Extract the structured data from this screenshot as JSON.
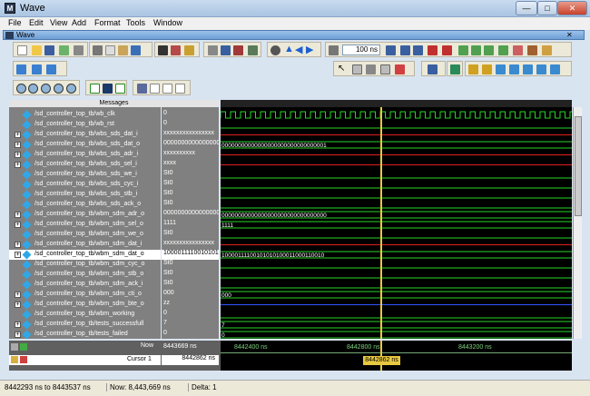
{
  "window": {
    "title": "Wave",
    "minimize": "—",
    "maximize": "□",
    "close": "✕"
  },
  "menu": [
    "File",
    "Edit",
    "View",
    "Add",
    "Format",
    "Tools",
    "Window"
  ],
  "pane": {
    "title": "Wave"
  },
  "toolbar": {
    "zoom_value": "100 ns"
  },
  "headers": {
    "messages": "Messages"
  },
  "signals": [
    {
      "name": "/sd_controller_top_tb/wb_clk",
      "value": "0",
      "expand": false
    },
    {
      "name": "/sd_controller_top_tb/wb_rst",
      "value": "0",
      "expand": false
    },
    {
      "name": "/sd_controller_top_tb/wbs_sds_dat_i",
      "value": "xxxxxxxxxxxxxxxx",
      "expand": true
    },
    {
      "name": "/sd_controller_top_tb/wbs_sds_dat_o",
      "value": "0000000000000000",
      "expand": true
    },
    {
      "name": "/sd_controller_top_tb/wbs_sds_adr_i",
      "value": "xxxxxxxxxx",
      "expand": true
    },
    {
      "name": "/sd_controller_top_tb/wbs_sds_sel_i",
      "value": "xxxx",
      "expand": true
    },
    {
      "name": "/sd_controller_top_tb/wbs_sds_we_i",
      "value": "St0",
      "expand": false
    },
    {
      "name": "/sd_controller_top_tb/wbs_sds_cyc_i",
      "value": "St0",
      "expand": false
    },
    {
      "name": "/sd_controller_top_tb/wbs_sds_stb_i",
      "value": "St0",
      "expand": false
    },
    {
      "name": "/sd_controller_top_tb/wbs_sds_ack_o",
      "value": "St0",
      "expand": false
    },
    {
      "name": "/sd_controller_top_tb/wbm_sdm_adr_o",
      "value": "0000000000000000",
      "expand": true
    },
    {
      "name": "/sd_controller_top_tb/wbm_sdm_sel_o",
      "value": "1111",
      "expand": true
    },
    {
      "name": "/sd_controller_top_tb/wbm_sdm_we_o",
      "value": "St0",
      "expand": false
    },
    {
      "name": "/sd_controller_top_tb/wbm_sdm_dat_i",
      "value": "xxxxxxxxxxxxxxxx",
      "expand": true
    },
    {
      "name": "/sd_controller_top_tb/wbm_sdm_dat_o",
      "value": "1000011110010101",
      "expand": true
    },
    {
      "name": "/sd_controller_top_tb/wbm_sdm_cyc_o",
      "value": "St0",
      "expand": false
    },
    {
      "name": "/sd_controller_top_tb/wbm_sdm_stb_o",
      "value": "St0",
      "expand": false
    },
    {
      "name": "/sd_controller_top_tb/wbm_sdm_ack_i",
      "value": "St0",
      "expand": false
    },
    {
      "name": "/sd_controller_top_tb/wbm_sdm_cti_o",
      "value": "000",
      "expand": true
    },
    {
      "name": "/sd_controller_top_tb/wbm_sdm_bte_o",
      "value": "zz",
      "expand": true
    },
    {
      "name": "/sd_controller_top_tb/wbm_working",
      "value": "0",
      "expand": false
    },
    {
      "name": "/sd_controller_top_tb/tests_successfull",
      "value": "7",
      "expand": true
    },
    {
      "name": "/sd_controller_top_tb/tests_failed",
      "value": "0",
      "expand": true
    }
  ],
  "wave_labels": {
    "dat_o": "00000000000000000000000000000001",
    "adr_o": "00000000000000000000000000000000",
    "sel_o": "1111",
    "dat_o2": "10000111100101010100011000110010",
    "cti": "000",
    "succ": "7",
    "fail": "0"
  },
  "bottom": {
    "now_label": "Now",
    "now_value": "8443669 ns",
    "cursor_label": "Cursor 1",
    "cursor_value": "8442862 ns",
    "t1": "8442400 ns",
    "t2": "8442800 ns",
    "t3": "8443200 ns",
    "cursor_flag": "8442862 ns"
  },
  "status": {
    "range": "8442293 ns to 8443537 ns",
    "now": "Now: 8,443,669 ns",
    "delta": "Delta: 1"
  }
}
